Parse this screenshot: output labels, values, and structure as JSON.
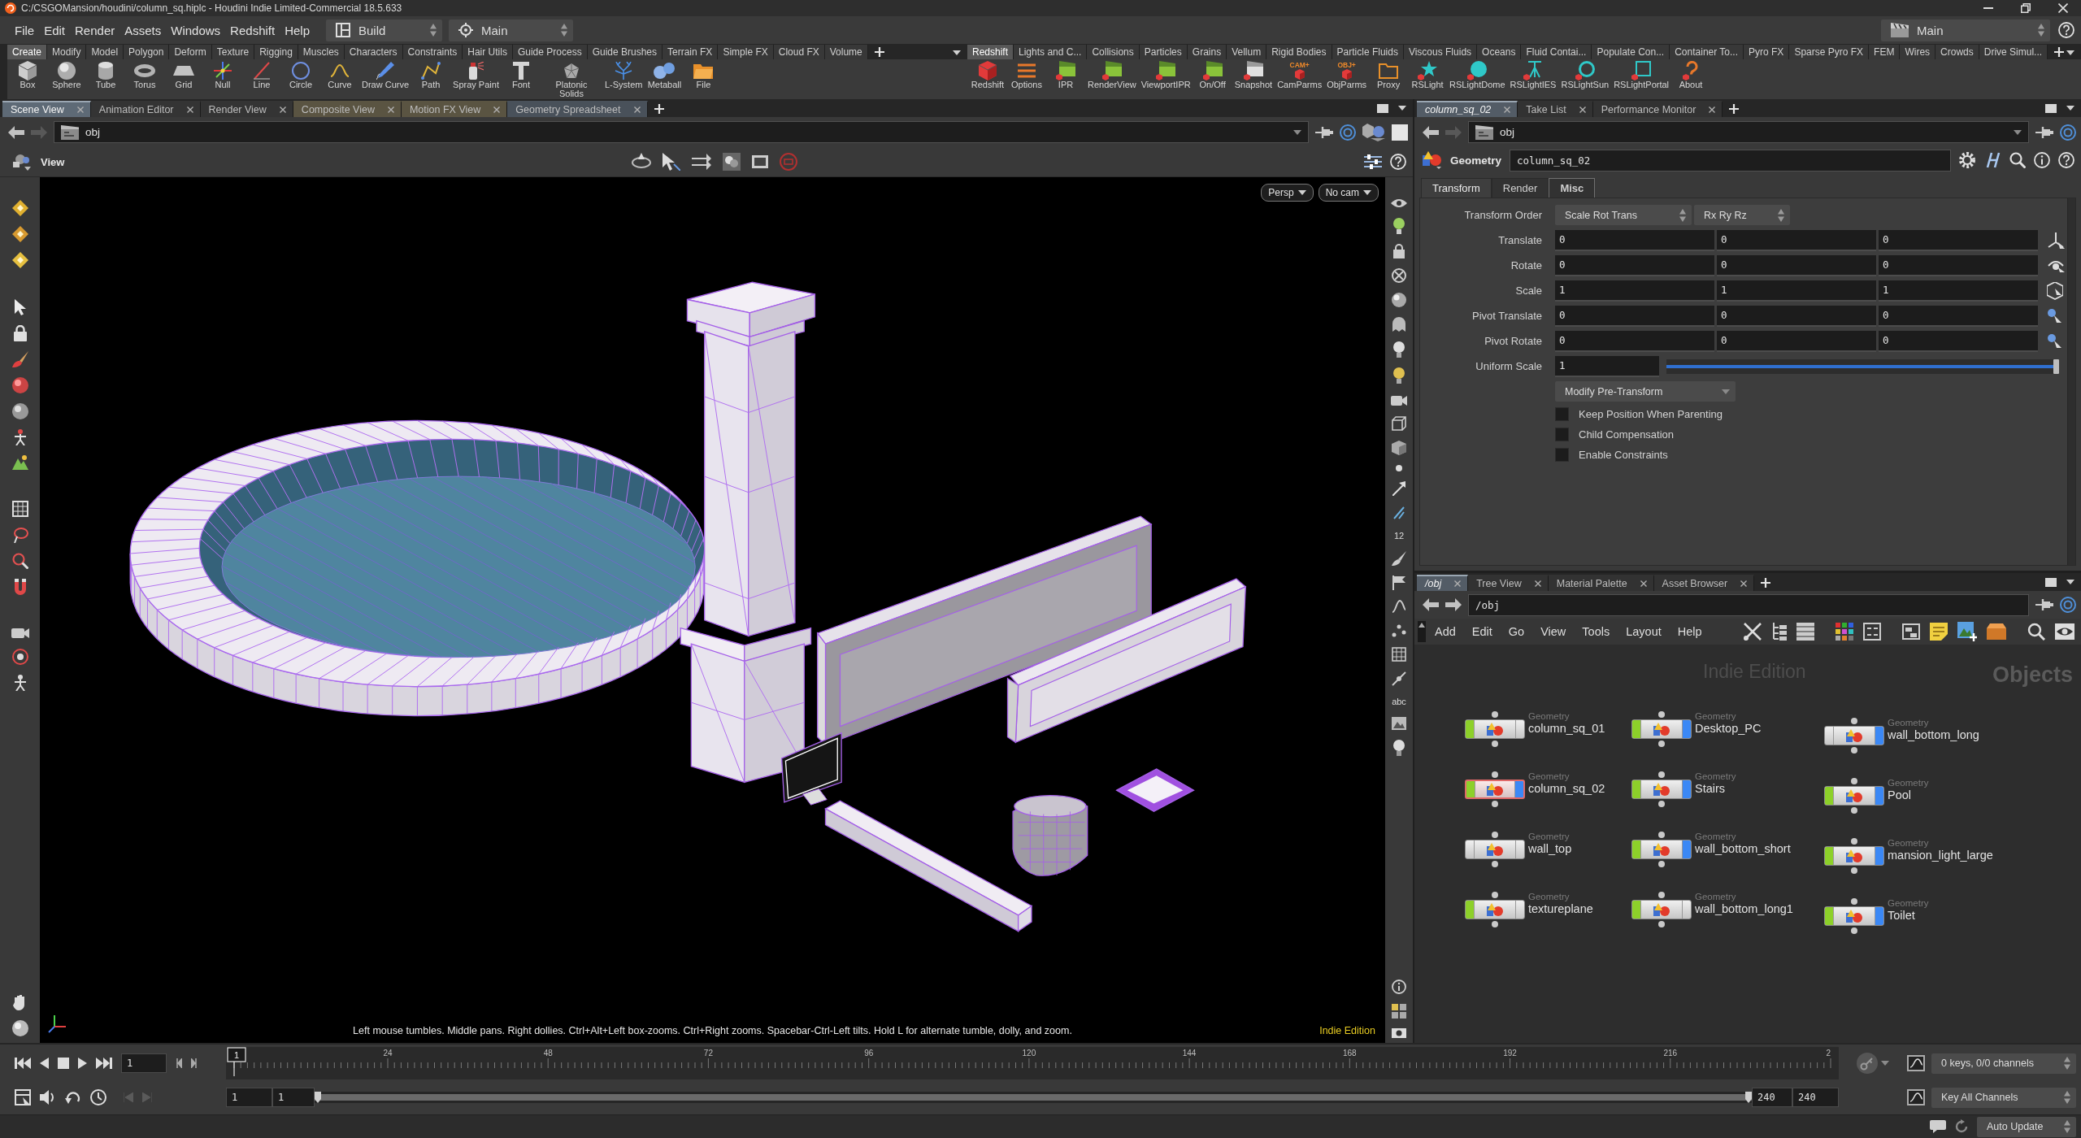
{
  "window": {
    "title": "C:/CSGOMansion/houdini/column_sq.hiplc - Houdini Indie Limited-Commercial 18.5.633"
  },
  "menu_bar": {
    "items": [
      "File",
      "Edit",
      "Render",
      "Assets",
      "Windows",
      "Redshift",
      "Help"
    ],
    "desktop": "Build",
    "layout": "Main",
    "right_layout": "Main"
  },
  "shelf_left": {
    "tabs": [
      {
        "label": "Create",
        "selected": true
      },
      {
        "label": "Modify",
        "selected": false
      },
      {
        "label": "Model",
        "selected": false
      },
      {
        "label": "Polygon",
        "selected": false
      },
      {
        "label": "Deform",
        "selected": false
      },
      {
        "label": "Texture",
        "selected": false
      },
      {
        "label": "Rigging",
        "selected": false
      },
      {
        "label": "Muscles",
        "selected": false
      },
      {
        "label": "Characters",
        "selected": false
      },
      {
        "label": "Constraints",
        "selected": false
      },
      {
        "label": "Hair Utils",
        "selected": false
      },
      {
        "label": "Guide Process",
        "selected": false
      },
      {
        "label": "Guide Brushes",
        "selected": false
      },
      {
        "label": "Terrain FX",
        "selected": false
      },
      {
        "label": "Simple FX",
        "selected": false
      },
      {
        "label": "Cloud FX",
        "selected": false
      },
      {
        "label": "Volume",
        "selected": false
      }
    ],
    "tools": [
      {
        "label": "Box"
      },
      {
        "label": "Sphere"
      },
      {
        "label": "Tube"
      },
      {
        "label": "Torus"
      },
      {
        "label": "Grid"
      },
      {
        "label": "Null"
      },
      {
        "label": "Line"
      },
      {
        "label": "Circle"
      },
      {
        "label": "Curve"
      },
      {
        "label": "Draw Curve"
      },
      {
        "label": "Path"
      },
      {
        "label": "Spray Paint"
      },
      {
        "label": "Font"
      },
      {
        "label": "Platonic Solids"
      },
      {
        "label": "L-System"
      },
      {
        "label": "Metaball"
      },
      {
        "label": "File"
      }
    ]
  },
  "shelf_right": {
    "tabs": [
      {
        "label": "Redshift",
        "selected": true
      },
      {
        "label": "Lights and C...",
        "selected": false
      },
      {
        "label": "Collisions",
        "selected": false
      },
      {
        "label": "Particles",
        "selected": false
      },
      {
        "label": "Grains",
        "selected": false
      },
      {
        "label": "Vellum",
        "selected": false
      },
      {
        "label": "Rigid Bodies",
        "selected": false
      },
      {
        "label": "Particle Fluids",
        "selected": false
      },
      {
        "label": "Viscous Fluids",
        "selected": false
      },
      {
        "label": "Oceans",
        "selected": false
      },
      {
        "label": "Fluid Contai...",
        "selected": false
      },
      {
        "label": "Populate Con...",
        "selected": false
      },
      {
        "label": "Container To...",
        "selected": false
      },
      {
        "label": "Pyro FX",
        "selected": false
      },
      {
        "label": "Sparse Pyro FX",
        "selected": false
      },
      {
        "label": "FEM",
        "selected": false
      },
      {
        "label": "Wires",
        "selected": false
      },
      {
        "label": "Crowds",
        "selected": false
      },
      {
        "label": "Drive Simul...",
        "selected": false
      }
    ],
    "tools": [
      {
        "label": "Redshift"
      },
      {
        "label": "Options"
      },
      {
        "label": "IPR"
      },
      {
        "label": "RenderView"
      },
      {
        "label": "ViewportIPR"
      },
      {
        "label": "On/Off"
      },
      {
        "label": "Snapshot"
      },
      {
        "label": "CamParms",
        "badge": "CAM+"
      },
      {
        "label": "ObjParms",
        "badge": "OBJ+"
      },
      {
        "label": "Proxy"
      },
      {
        "label": "RSLight"
      },
      {
        "label": "RSLightDome"
      },
      {
        "label": "RSLightIES"
      },
      {
        "label": "RSLightSun"
      },
      {
        "label": "RSLightPortal"
      },
      {
        "label": "About"
      }
    ]
  },
  "scene_pane": {
    "tabs": [
      {
        "label": "Scene View",
        "selected": true,
        "color": "#5e6a76"
      },
      {
        "label": "Animation Editor",
        "selected": false,
        "color": "#343434"
      },
      {
        "label": "Render View",
        "selected": false,
        "color": "#343434"
      },
      {
        "label": "Composite View",
        "selected": false,
        "color": "#5a5442"
      },
      {
        "label": "Motion FX View",
        "selected": false,
        "color": "#5a5442"
      },
      {
        "label": "Geometry Spreadsheet",
        "selected": false,
        "color": "#49515a"
      }
    ],
    "path": "obj",
    "toolbar_title": "View",
    "camera": "Persp",
    "cam_menu": "No cam",
    "display_labels": [
      "12",
      "abc"
    ],
    "hint": "Left mouse tumbles. Middle pans. Right dollies. Ctrl+Alt+Left box-zooms. Ctrl+Right zooms. Spacebar-Ctrl-Left tilts. Hold L for alternate tumble, dolly, and zoom.",
    "edition": "Indie Edition"
  },
  "param_pane": {
    "tabs": [
      {
        "label": "column_sq_02",
        "kind": "node",
        "selected": true
      },
      {
        "label": "Take List",
        "kind": "pane",
        "selected": false
      },
      {
        "label": "Performance Monitor",
        "kind": "pane",
        "selected": false
      }
    ],
    "path": "obj",
    "node_type": "Geometry",
    "node_name": "column_sq_02",
    "folders": [
      {
        "label": "Transform",
        "selected": true,
        "highlighted": false
      },
      {
        "label": "Render",
        "selected": false,
        "highlighted": false
      },
      {
        "label": "Misc",
        "selected": false,
        "highlighted": true
      }
    ],
    "transform_order": {
      "label": "Transform Order",
      "order": "Scale Rot Trans",
      "rotation": "Rx Ry Rz"
    },
    "vectors": [
      {
        "label": "Translate",
        "values": [
          "0",
          "0",
          "0"
        ]
      },
      {
        "label": "Rotate",
        "values": [
          "0",
          "0",
          "0"
        ]
      },
      {
        "label": "Scale",
        "values": [
          "1",
          "1",
          "1"
        ]
      },
      {
        "label": "Pivot Translate",
        "values": [
          "0",
          "0",
          "0"
        ]
      },
      {
        "label": "Pivot Rotate",
        "values": [
          "0",
          "0",
          "0"
        ]
      }
    ],
    "uniform_scale": {
      "label": "Uniform Scale",
      "value": "1",
      "level": 1
    },
    "pre_transform": "Modify Pre-Transform",
    "toggles": [
      {
        "label": "Keep Position When Parenting",
        "checked": false
      },
      {
        "label": "Child Compensation",
        "checked": false
      },
      {
        "label": "Enable Constraints",
        "checked": false
      }
    ]
  },
  "network_pane": {
    "tabs": [
      {
        "label": "/obj",
        "kind": "node",
        "selected": true
      },
      {
        "label": "Tree View",
        "kind": "pane",
        "selected": false
      },
      {
        "label": "Material Palette",
        "kind": "pane",
        "selected": false
      },
      {
        "label": "Asset Browser",
        "kind": "pane",
        "selected": false
      }
    ],
    "path": "/obj",
    "menu": [
      "Add",
      "Edit",
      "Go",
      "View",
      "Tools",
      "Layout",
      "Help"
    ],
    "edition": "Indie Edition",
    "context": "Objects",
    "nodes": [
      {
        "type": "Geometry",
        "name": "column_sq_01",
        "selectable": true,
        "display": false,
        "selected": false
      },
      {
        "type": "Geometry",
        "name": "Desktop_PC",
        "selectable": true,
        "display": true,
        "selected": false
      },
      {
        "type": "Geometry",
        "name": "wall_bottom_long",
        "selectable": false,
        "display": true,
        "selected": false
      },
      {
        "type": "Geometry",
        "name": "column_sq_02",
        "selectable": true,
        "display": true,
        "selected": true
      },
      {
        "type": "Geometry",
        "name": "Stairs",
        "selectable": true,
        "display": true,
        "selected": false
      },
      {
        "type": "Geometry",
        "name": "Pool",
        "selectable": true,
        "display": true,
        "selected": false
      },
      {
        "type": "Geometry",
        "name": "wall_top",
        "selectable": false,
        "display": false,
        "selected": false
      },
      {
        "type": "Geometry",
        "name": "wall_bottom_short",
        "selectable": true,
        "display": true,
        "selected": false
      },
      {
        "type": "Geometry",
        "name": "mansion_light_large",
        "selectable": true,
        "display": true,
        "selected": false
      },
      {
        "type": "Geometry",
        "name": "textureplane",
        "selectable": true,
        "display": false,
        "selected": false
      },
      {
        "type": "Geometry",
        "name": "wall_bottom_long1",
        "selectable": true,
        "display": false,
        "selected": false
      },
      {
        "type": "Geometry",
        "name": "Toilet",
        "selectable": true,
        "display": true,
        "selected": false
      }
    ]
  },
  "timeline": {
    "frame": "1",
    "marker": "1",
    "ruler_labels": [
      "24",
      "48",
      "72",
      "96",
      "120",
      "144",
      "168",
      "192",
      "216",
      "2"
    ],
    "start": "1",
    "range_start": "1",
    "playback_range": {
      "level": 1
    },
    "range_end": "240",
    "end": "240",
    "keys": "0 keys, 0/0 channels",
    "key_mode": "Key All Channels"
  },
  "status_bar": {
    "update_mode": "Auto Update"
  }
}
